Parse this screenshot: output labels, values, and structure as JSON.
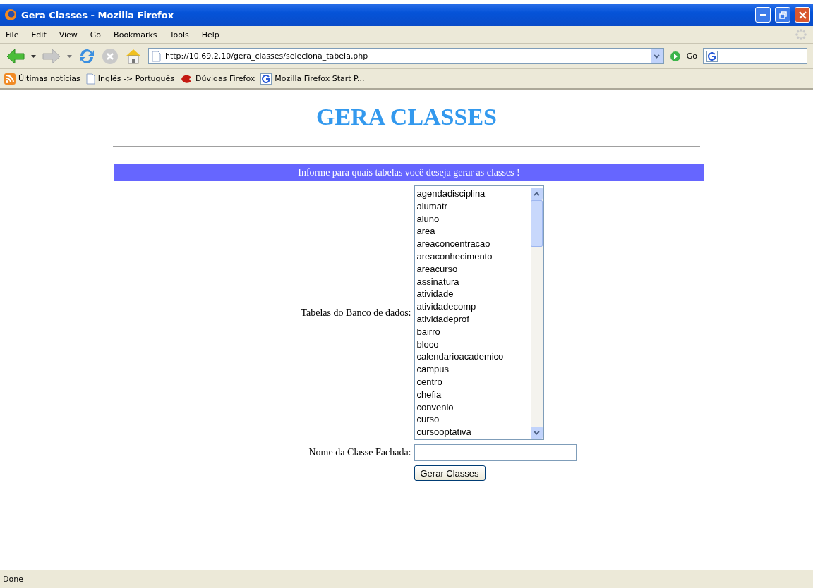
{
  "window": {
    "title": "Gera Classes - Mozilla Firefox"
  },
  "menu": [
    "File",
    "Edit",
    "View",
    "Go",
    "Bookmarks",
    "Tools",
    "Help"
  ],
  "address_bar": {
    "value": "http://10.69.2.10/gera_classes/seleciona_tabela.php",
    "go_label": "Go"
  },
  "bookmarks": [
    {
      "kind": "feed",
      "label": "Últimas notícias"
    },
    {
      "kind": "page",
      "label": "Inglês -> Português"
    },
    {
      "kind": "bird",
      "label": "Dúvidas Firefox"
    },
    {
      "kind": "google",
      "label": "Mozilla Firefox Start P..."
    }
  ],
  "page": {
    "heading": "GERA CLASSES",
    "banner": "Informe para quais tabelas você deseja gerar as classes !",
    "tables_label": "Tabelas do Banco de dados:",
    "tables": [
      "agendadisciplina",
      "alumatr",
      "aluno",
      "area",
      "areaconcentracao",
      "areaconhecimento",
      "areacurso",
      "assinatura",
      "atividade",
      "atividadecomp",
      "atividadeprof",
      "bairro",
      "bloco",
      "calendarioacademico",
      "campus",
      "centro",
      "chefia",
      "convenio",
      "curso",
      "cursooptativa"
    ],
    "class_name_label": "Nome da Classe Fachada:",
    "submit": "Gerar Classes"
  },
  "status_bar": "Done"
}
